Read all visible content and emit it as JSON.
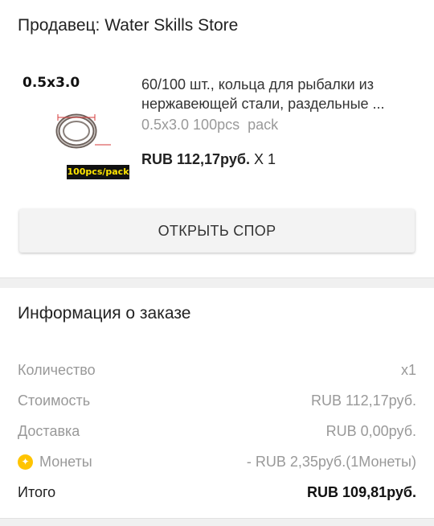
{
  "seller": {
    "label": "Продавец: Water Skills Store"
  },
  "product": {
    "image_size_text": "0.5x3.0",
    "image_pack_label": "100pcs/pack",
    "title_line1": "60/100 шт., кольца для рыбалки из",
    "title_line2": "нержавеющей стали, раздельные ...",
    "variant": "0.5x3.0 100pcs  pack",
    "price": "RUB 112,17руб.",
    "quantity": "X 1"
  },
  "dispute_button": {
    "label": "ОТКРЫТЬ СПОР"
  },
  "order_info": {
    "title": "Информация о заказе",
    "rows": [
      {
        "label": "Количество",
        "value": "x1"
      },
      {
        "label": "Стоимость",
        "value": "RUB 112,17руб."
      },
      {
        "label": "Доставка",
        "value": "RUB 0,00руб."
      },
      {
        "label": "Монеты",
        "value": "- RUB 2,35руб.(1Монеты)",
        "icon": "coin-icon"
      },
      {
        "label": "Итого",
        "value": "RUB 109,81руб."
      }
    ]
  },
  "colors": {
    "coin": "#ffc400",
    "pack_label_text": "#ffe500",
    "muted_text": "#999999",
    "separator": "#f0f0f0"
  }
}
